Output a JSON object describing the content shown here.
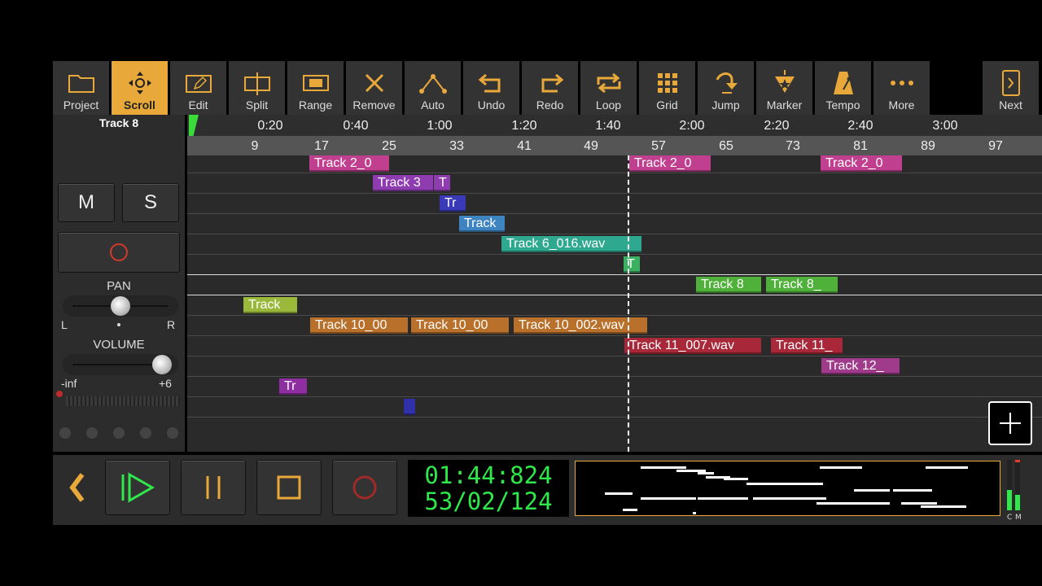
{
  "toolbar": {
    "buttons": [
      {
        "label": "Project",
        "icon": "folder-icon"
      },
      {
        "label": "Scroll",
        "icon": "move-icon",
        "active": true
      },
      {
        "label": "Edit",
        "icon": "edit-icon"
      },
      {
        "label": "Split",
        "icon": "split-icon"
      },
      {
        "label": "Range",
        "icon": "range-icon"
      },
      {
        "label": "Remove",
        "icon": "remove-icon"
      },
      {
        "label": "Auto",
        "icon": "automation-icon"
      },
      {
        "label": "Undo",
        "icon": "undo-icon"
      },
      {
        "label": "Redo",
        "icon": "redo-icon"
      },
      {
        "label": "Loop",
        "icon": "loop-icon"
      },
      {
        "label": "Grid",
        "icon": "grid-icon"
      },
      {
        "label": "Jump",
        "icon": "jump-icon"
      },
      {
        "label": "Marker",
        "icon": "marker-icon"
      },
      {
        "label": "Tempo",
        "icon": "metronome-icon"
      },
      {
        "label": "More",
        "icon": "more-icon"
      }
    ],
    "next_label": "Next"
  },
  "track_panel": {
    "track_name": "Track 8",
    "mute_label": "M",
    "solo_label": "S",
    "pan_label": "PAN",
    "pan_left": "L",
    "pan_right": "R",
    "pan_value": 0.5,
    "volume_label": "VOLUME",
    "volume_min": "-inf",
    "volume_max": "+6",
    "volume_value": 0.93
  },
  "ruler": {
    "times": [
      "0:20",
      "0:40",
      "1:00",
      "1:20",
      "1:40",
      "2:00",
      "2:20",
      "2:40",
      "3:00"
    ],
    "bars": [
      "9",
      "17",
      "25",
      "33",
      "41",
      "49",
      "57",
      "65",
      "73",
      "81",
      "89",
      "97"
    ]
  },
  "clips": [
    {
      "lane": 0,
      "label": "Track 2_0",
      "color": "#c0408f"
    },
    {
      "lane": 0,
      "label": "Track 2_0",
      "color": "#c0408f"
    },
    {
      "lane": 0,
      "label": "Track 2_0",
      "color": "#c0408f"
    },
    {
      "lane": 1,
      "label": "Track 3",
      "color": "#8e3cb0"
    },
    {
      "lane": 1,
      "label": "T",
      "color": "#8e3cb0"
    },
    {
      "lane": 2,
      "label": "Tr",
      "color": "#3a3ab8"
    },
    {
      "lane": 3,
      "label": "Track",
      "color": "#3d84c0"
    },
    {
      "lane": 4,
      "label": "Track 6_016.wav",
      "color": "#2fa890"
    },
    {
      "lane": 5,
      "label": "T",
      "color": "#3ab060"
    },
    {
      "lane": 6,
      "label": "Track 8",
      "color": "#4fb03a"
    },
    {
      "lane": 6,
      "label": "Track 8_",
      "color": "#4fb03a"
    },
    {
      "lane": 7,
      "label": "Track",
      "color": "#9ab83a"
    },
    {
      "lane": 8,
      "label": "Track 10_00",
      "color": "#b8702a"
    },
    {
      "lane": 8,
      "label": "Track 10_00",
      "color": "#b8702a"
    },
    {
      "lane": 8,
      "label": "Track 10_002.wav",
      "color": "#b8702a"
    },
    {
      "lane": 9,
      "label": "Track 11_007.wav",
      "color": "#a8283a"
    },
    {
      "lane": 9,
      "label": "Track 11_",
      "color": "#a8283a"
    },
    {
      "lane": 10,
      "label": "Track 12_",
      "color": "#a03a8a"
    },
    {
      "lane": 11,
      "label": "Tr",
      "color": "#8e2ea0"
    },
    {
      "lane": 12,
      "label": "",
      "color": "#3030a8"
    }
  ],
  "transport": {
    "time": "01:44:824",
    "position": "53/02/124",
    "meter_labels": [
      "C",
      "M"
    ]
  }
}
